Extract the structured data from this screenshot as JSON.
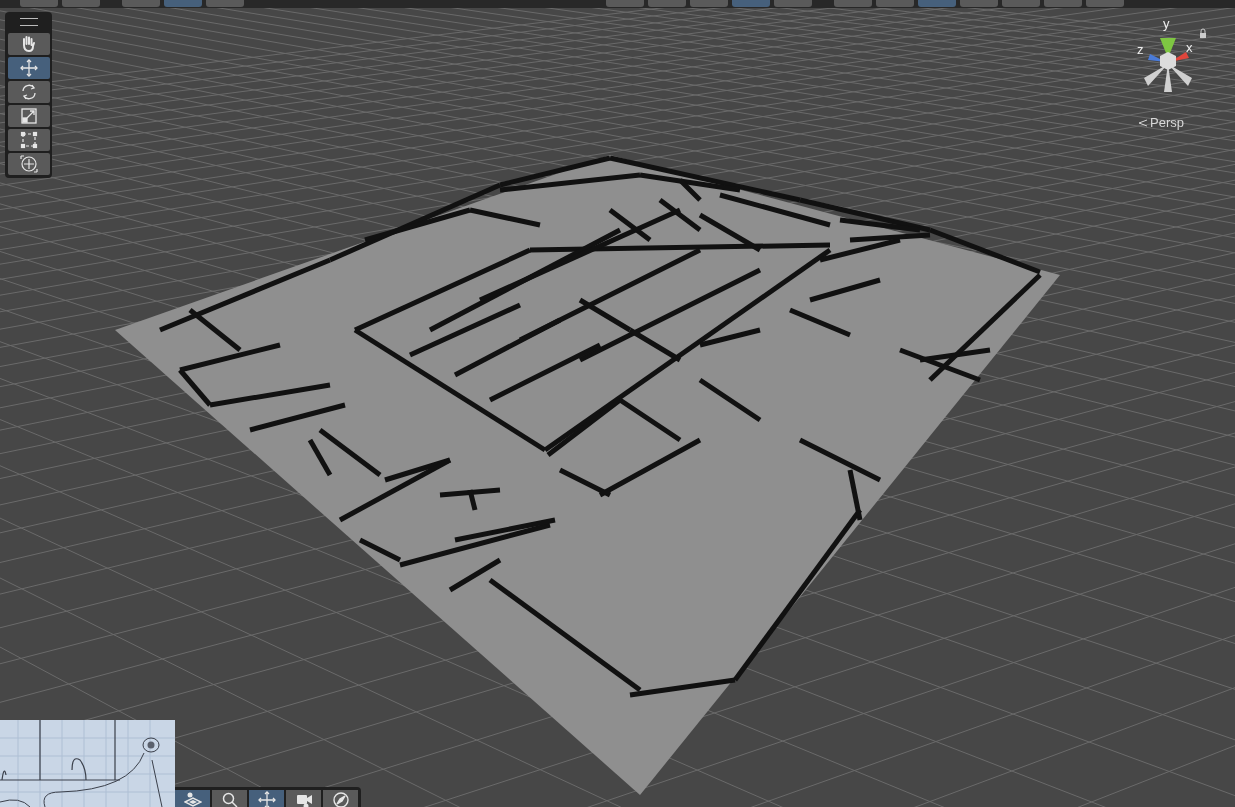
{
  "top_toolbar": {
    "groups": [
      {
        "buttons": [
          {
            "selected": false
          },
          {
            "selected": false
          }
        ]
      },
      {
        "buttons": [
          {
            "selected": false
          },
          {
            "selected": true
          },
          {
            "selected": false
          }
        ]
      },
      {
        "buttons": [
          {
            "selected": false
          },
          {
            "selected": false
          },
          {
            "selected": false
          },
          {
            "selected": true
          },
          {
            "selected": false
          }
        ]
      },
      {
        "buttons": [
          {
            "selected": false
          },
          {
            "selected": false
          },
          {
            "selected": true
          },
          {
            "selected": false
          },
          {
            "selected": false
          },
          {
            "selected": false
          },
          {
            "selected": false
          }
        ]
      }
    ]
  },
  "tools": [
    {
      "kind": "hand",
      "selected": false
    },
    {
      "kind": "move",
      "selected": true
    },
    {
      "kind": "rotate",
      "selected": false
    },
    {
      "kind": "scale",
      "selected": false
    },
    {
      "kind": "rect",
      "selected": false
    },
    {
      "kind": "transform",
      "selected": false
    }
  ],
  "gizmo": {
    "y_label": "y",
    "x_label": "x",
    "z_label": "z",
    "projection": "Persp"
  },
  "overlay_toolbar": [
    {
      "kind": "layers",
      "selected": true
    },
    {
      "kind": "search",
      "selected": false
    },
    {
      "kind": "move",
      "selected": true
    },
    {
      "kind": "camera",
      "selected": false
    },
    {
      "kind": "compass",
      "selected": false
    }
  ]
}
